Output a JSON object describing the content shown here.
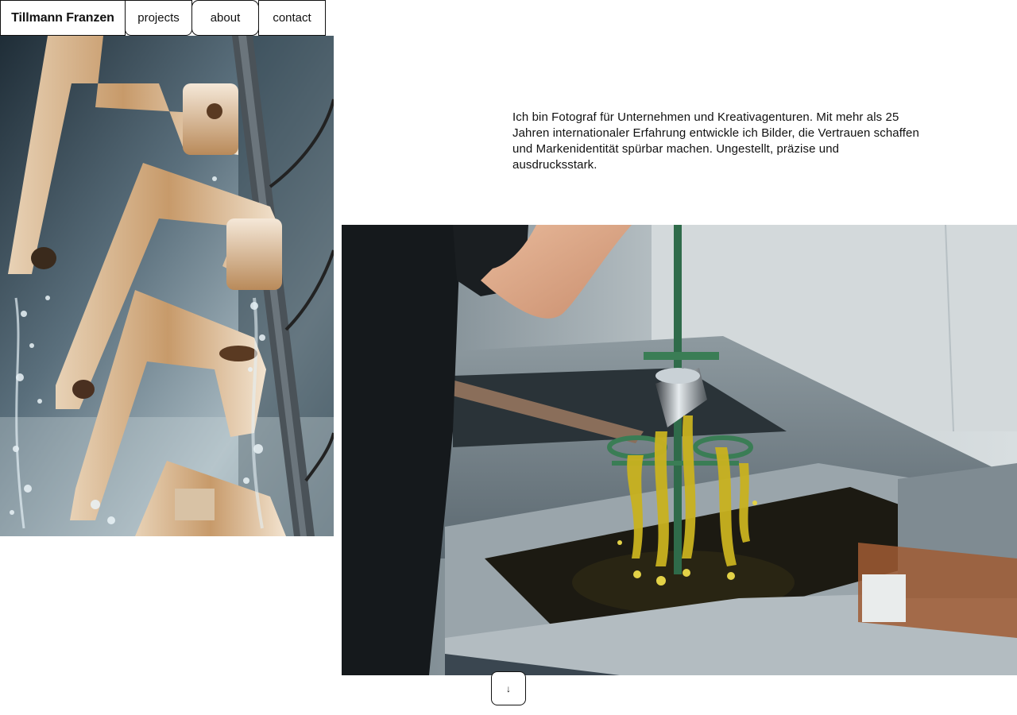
{
  "nav": {
    "brand": "Tillmann Franzen",
    "items": [
      {
        "label": "projects"
      },
      {
        "label": "about"
      },
      {
        "label": "contact"
      }
    ]
  },
  "intro": {
    "text": "Ich bin Fotograf für Unternehmen und Kreativagenturen. Mit mehr als 25 Jahren internationaler Erfahrung entwickle ich Bilder, die Vertrauen schaffen und Markenidentität spürbar machen. Ungestellt, präzise und ausdrucksstark."
  },
  "scroll": {
    "icon": "↓"
  }
}
